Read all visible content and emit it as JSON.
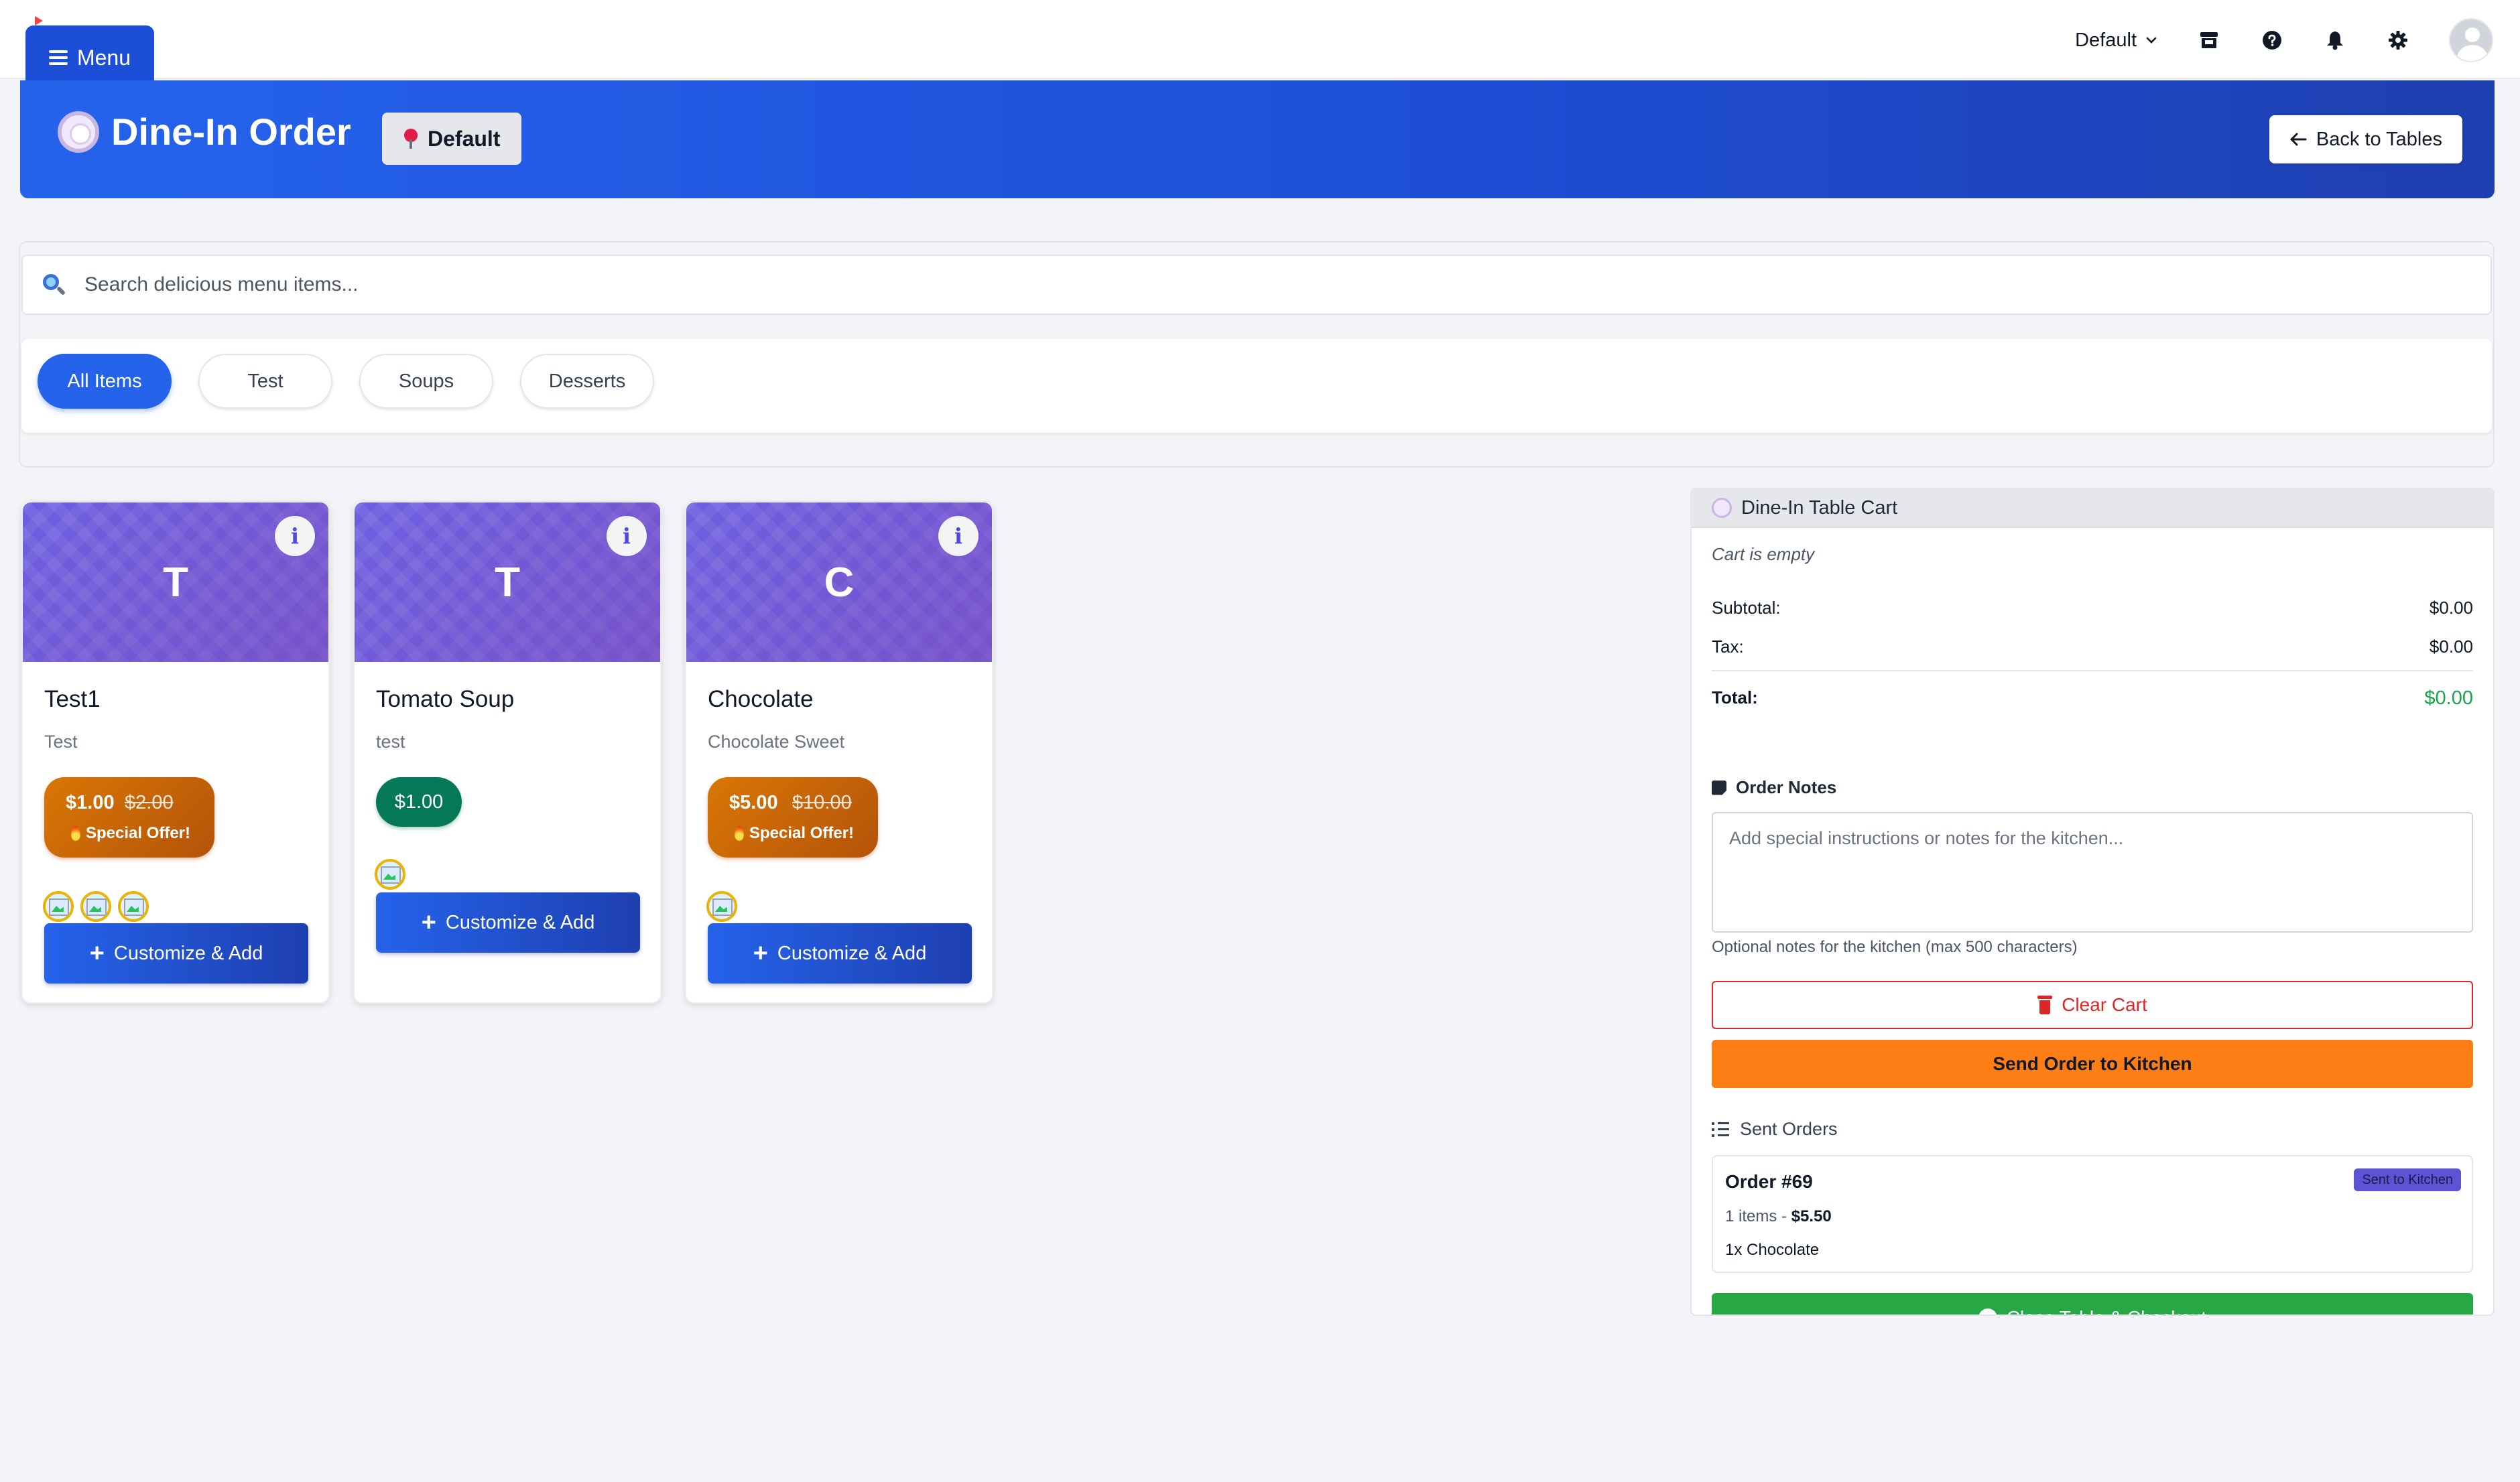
{
  "topbar": {
    "menu_label": "Menu",
    "store_select": "Default",
    "icons": [
      "store-icon",
      "help-icon",
      "bell-icon",
      "gear-icon",
      "avatar"
    ]
  },
  "header": {
    "title": "Dine-In Order",
    "location_badge": "Default",
    "back_button": "Back to Tables"
  },
  "search": {
    "placeholder": "Search delicious menu items...",
    "value": ""
  },
  "categories": [
    {
      "label": "All Items",
      "active": true
    },
    {
      "label": "Test",
      "active": false
    },
    {
      "label": "Soups",
      "active": false
    },
    {
      "label": "Desserts",
      "active": false
    }
  ],
  "menu_items": [
    {
      "initial": "T",
      "name": "Test1",
      "description": "Test",
      "price": "$1.00",
      "original_price": "$2.00",
      "special_offer": "Special Offer!",
      "thumbnail_count": 3,
      "action": "Customize & Add"
    },
    {
      "initial": "T",
      "name": "Tomato Soup",
      "description": "test",
      "price": "$1.00",
      "original_price": null,
      "special_offer": null,
      "thumbnail_count": 1,
      "action": "Customize & Add"
    },
    {
      "initial": "C",
      "name": "Chocolate",
      "description": "Chocolate Sweet",
      "price": "$5.00",
      "original_price": "$10.00",
      "special_offer": "Special Offer!",
      "thumbnail_count": 1,
      "action": "Customize & Add"
    }
  ],
  "cart": {
    "title": "Dine-In Table Cart",
    "empty_text": "Cart is empty",
    "subtotal_label": "Subtotal:",
    "subtotal": "$0.00",
    "tax_label": "Tax:",
    "tax": "$0.00",
    "total_label": "Total:",
    "total": "$0.00",
    "notes_label": "Order Notes",
    "notes_placeholder": "Add special instructions or notes for the kitchen...",
    "notes_help": "Optional notes for the kitchen (max 500 characters)",
    "clear_button": "Clear Cart",
    "send_button": "Send Order to Kitchen",
    "sent_orders_label": "Sent Orders",
    "sent_orders": [
      {
        "title": "Order #69",
        "status": "Sent to Kitchen",
        "item_count_text": "1 items - ",
        "amount": "$5.50",
        "line": "1x Chocolate"
      }
    ],
    "checkout_button": "Close Table & Checkout"
  },
  "colors": {
    "primary": "#2563eb",
    "special_offer": "#d97706",
    "price_green": "#047857",
    "send": "#fd7e14",
    "checkout": "#28a745",
    "danger": "#dc2626"
  }
}
